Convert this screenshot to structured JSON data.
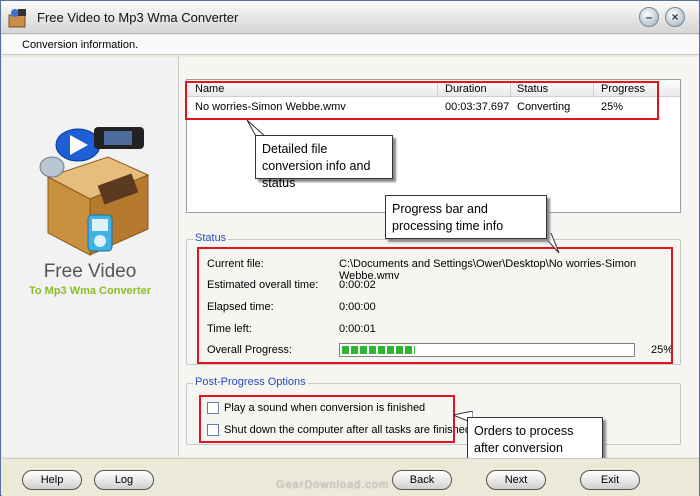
{
  "window": {
    "title": "Free Video to Mp3 Wma Converter"
  },
  "info_strip": {
    "text": "Conversion information."
  },
  "brand": {
    "line1": "Free Video",
    "line2": "To Mp3 Wma Converter"
  },
  "file_list": {
    "headers": [
      "Name",
      "Duration",
      "Status",
      "Progress"
    ],
    "rows": [
      {
        "name": "No worries-Simon Webbe.wmv",
        "duration": "00:03:37.697",
        "status": "Converting",
        "progress": "25%"
      }
    ]
  },
  "status": {
    "title": "Status",
    "current_file_label": "Current file:",
    "current_file": "C:\\Documents and Settings\\Ower\\Desktop\\No worries-Simon Webbe.wmv",
    "estimated_label": "Estimated overall time:",
    "estimated": "0:00:02",
    "elapsed_label": "Elapsed time:",
    "elapsed": "0:00:00",
    "left_label": "Time left:",
    "left": "0:00:01",
    "overall_label": "Overall Progress:",
    "overall_percent": "25%",
    "overall_fraction": 0.25
  },
  "post": {
    "title": "Post-Progress Options",
    "play_sound": "Play a sound when conversion is finished",
    "shutdown": "Shut down the computer after all tasks are finished"
  },
  "buttons": {
    "help": "Help",
    "log": "Log",
    "back": "Back",
    "next": "Next",
    "exit": "Exit"
  },
  "callouts": {
    "file_info": "Detailed file conversion info and status",
    "progress": "Progress bar and processing time info",
    "orders": "Orders to process after conversion"
  },
  "watermark": "GearDownload.com",
  "colors": {
    "accent_red": "#e0141c",
    "progress_green": "#2fb52f",
    "group_label_blue": "#2a4bb8",
    "brand_green": "#8bbd2a"
  }
}
